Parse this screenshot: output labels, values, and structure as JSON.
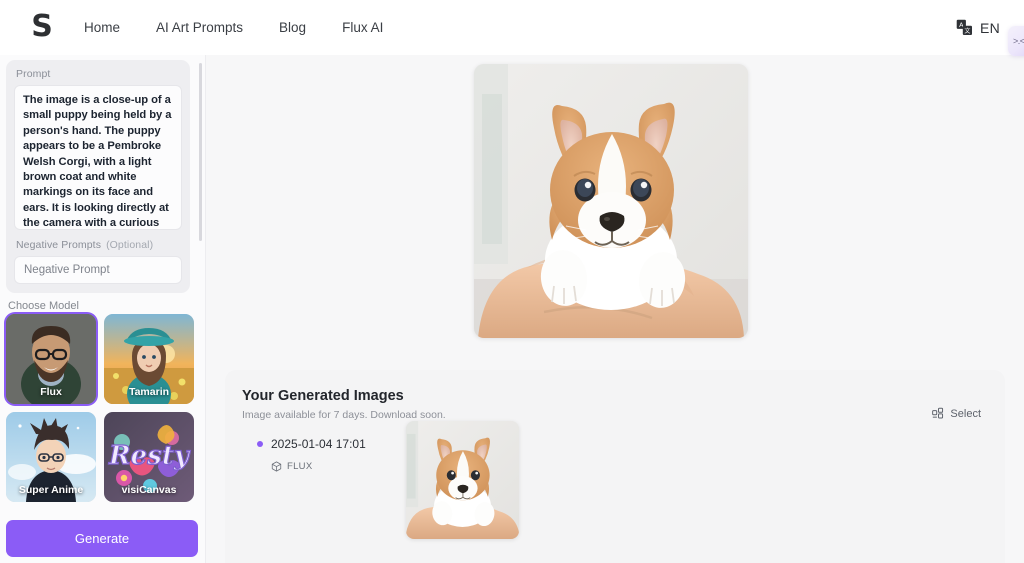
{
  "header": {
    "logo_text": "S",
    "logo_name": "site-logo",
    "nav": [
      {
        "label": "Home"
      },
      {
        "label": "AI Art Prompts"
      },
      {
        "label": "Blog"
      },
      {
        "label": "Flux AI"
      }
    ],
    "language": {
      "icon": "translate-icon",
      "label": "EN"
    },
    "corner_chip_icon": "widget-chip-icon"
  },
  "sidebar": {
    "prompt": {
      "label": "Prompt",
      "value": "The image is a close-up of a small puppy being held by a person's hand. The puppy appears to be a Pembroke Welsh Corgi, with a light brown coat and white markings on its face and ears. It is looking directly at the camera with a curious expression. The background is blurred, but it seems to be an indoor setting"
    },
    "negative_prompt": {
      "label": "Negative Prompts",
      "optional_tag": "(Optional)",
      "placeholder": "Negative Prompt",
      "value": ""
    },
    "choose_model_label": "Choose Model",
    "models": [
      {
        "name": "Flux",
        "selected": true
      },
      {
        "name": "Tamarin",
        "selected": false
      },
      {
        "name": "Super Anime",
        "selected": false
      },
      {
        "name": "visiCanvas",
        "selected": false
      }
    ],
    "generate_button": "Generate"
  },
  "main": {
    "hero_image_alt": "corgi-puppy-held-in-hands",
    "results": {
      "title": "Your Generated Images",
      "subtitle": "Image available for 7 days. Download soon.",
      "select_label": "Select",
      "select_icon": "grid-select-icon",
      "items": [
        {
          "timestamp": "2025-01-04 17:01",
          "model_icon": "cube-icon",
          "model": "FLUX",
          "thumbnail_alt": "corgi-puppy-thumbnail"
        }
      ]
    }
  },
  "colors": {
    "accent": "#8b5cf6",
    "page_bg": "#f7f7f8",
    "sidebar_bg": "#fbfbfc",
    "panel_bg": "#eeeef1",
    "card_bg": "#f4f4f5",
    "text_primary": "#23262c",
    "text_muted": "#8d9098"
  }
}
